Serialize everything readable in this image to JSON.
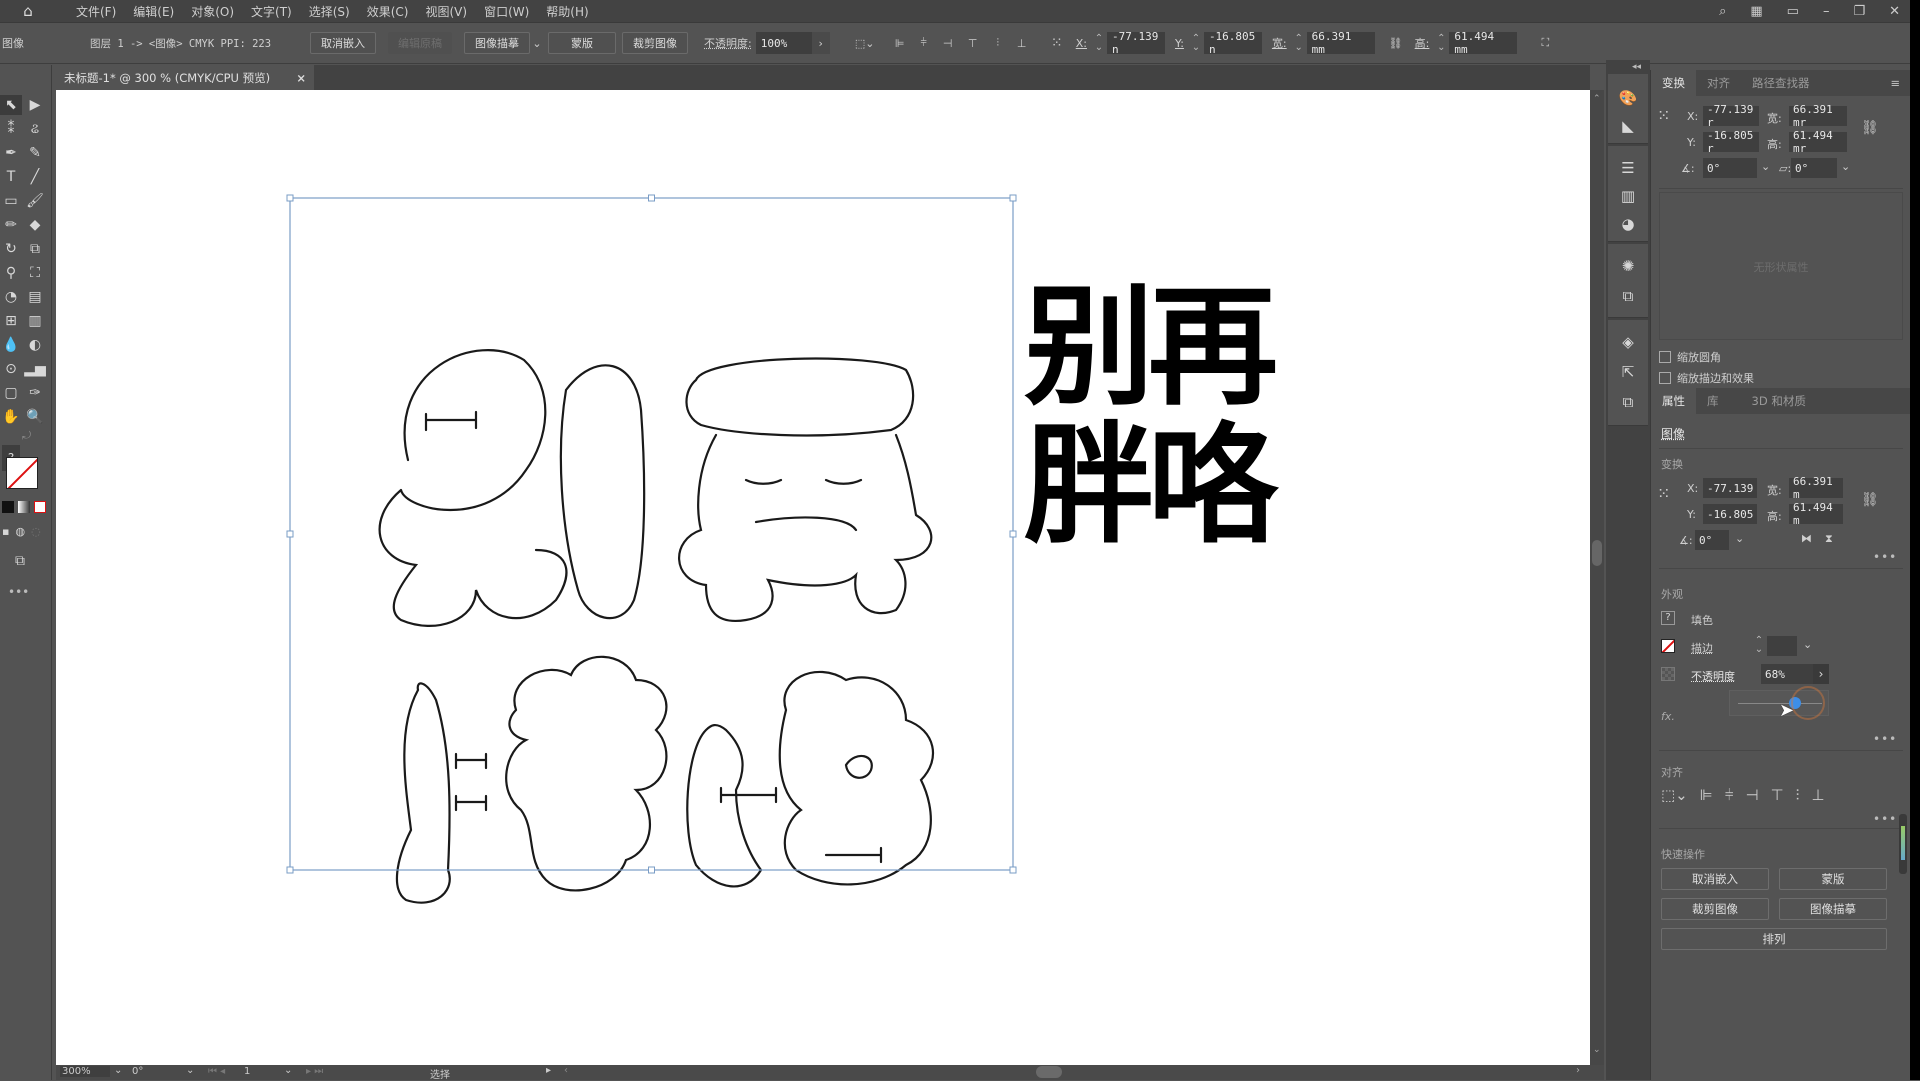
{
  "menubar": {
    "items": [
      "文件(F)",
      "编辑(E)",
      "对象(O)",
      "文字(T)",
      "选择(S)",
      "效果(C)",
      "视图(V)",
      "窗口(W)",
      "帮助(H)"
    ]
  },
  "controlbar": {
    "object_type": "图像",
    "layer_info": "图层 1 -> <图像> CMYK PPI: 223",
    "unembed": "取消嵌入",
    "edit_original": "编辑原稿",
    "image_trace": "图像描摹",
    "mask": "蒙版",
    "crop_image": "裁剪图像",
    "opacity_label": "不透明度:",
    "opacity_value": "100%",
    "x_label": "X:",
    "x_value": "-77.139 n",
    "y_label": "Y:",
    "y_value": "-16.805 n",
    "w_label": "宽:",
    "w_value": "66.391 mm",
    "h_label": "高:",
    "h_value": "61.494 mm"
  },
  "document_tab": {
    "title": "未标题-1* @ 300 % (CMYK/CPU 预览)",
    "close": "×"
  },
  "artwork": {
    "sample_text_line1": "别再",
    "sample_text_line2": "胖咯"
  },
  "statusbar": {
    "zoom": "300%",
    "rotation": "0°",
    "artboard": "1",
    "tool": "选择"
  },
  "panel": {
    "top_tabs": [
      "变换",
      "对齐",
      "路径查找器"
    ],
    "transform": {
      "x_label": "X:",
      "x_value": "-77.139 r",
      "y_label": "Y:",
      "y_value": "-16.805 r",
      "w_label": "宽:",
      "w_value": "66.391 mr",
      "h_label": "高:",
      "h_value": "61.494 mr",
      "angle": "0°",
      "shear": "0°",
      "no_shape": "无形状属性",
      "scale_corners": "缩放圆角",
      "scale_strokes": "缩放描边和效果"
    },
    "bottom_tabs": [
      "属性",
      "库",
      "3D 和材质"
    ],
    "object_kind": "图像",
    "props_transform": {
      "title": "变换",
      "x_label": "X:",
      "x_value": "-77.139",
      "y_label": "Y:",
      "y_value": "-16.805",
      "w_label": "宽:",
      "w_value": "66.391 m",
      "h_label": "高:",
      "h_value": "61.494 m",
      "angle": "0°"
    },
    "appearance": {
      "title": "外观",
      "fill": "填色",
      "stroke": "描边",
      "opacity_label": "不透明度",
      "opacity_value": "68%",
      "opacity_slider": 0.68,
      "fx": "fx."
    },
    "align_title": "对齐",
    "quick_actions": {
      "title": "快速操作",
      "unembed": "取消嵌入",
      "mask": "蒙版",
      "crop": "裁剪图像",
      "trace": "图像描摹",
      "arrange": "排列"
    }
  },
  "colors": {
    "ui_bg": "#535353",
    "menubar_bg": "#434343",
    "selection": "#7a9cc6",
    "slider_accent": "#3d8ee8"
  }
}
